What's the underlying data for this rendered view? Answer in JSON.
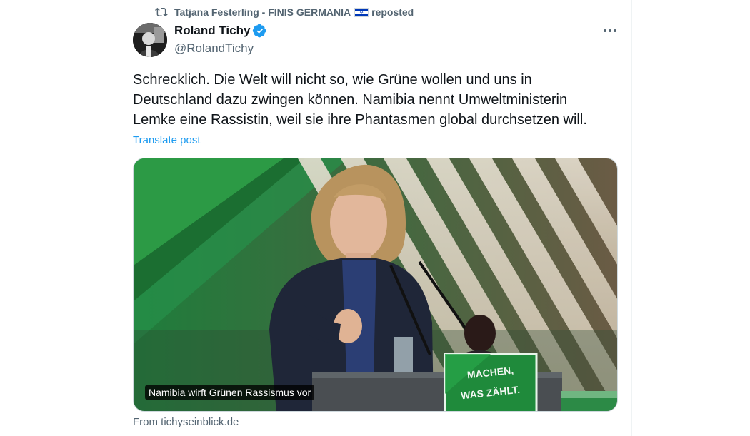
{
  "repost": {
    "reposter": "Tatjana Festerling - FINIS GERMANIA",
    "suffix": "reposted",
    "icon": "repost-icon",
    "flag": "israel-flag-icon"
  },
  "author": {
    "name": "Roland Tichy",
    "handle": "@RolandTichy",
    "verified_icon": "verified-badge-icon",
    "verified_color": "#1d9bf0"
  },
  "post": {
    "lines": [
      "Schrecklich. Die Welt will nicht so, wie Grüne wollen und uns in",
      "Deutschland dazu zwingen können. Namibia nennt Umweltministerin",
      "Lemke eine Rassistin, weil sie ihre Phantasmen global durchsetzen will."
    ],
    "translate_label": "Translate post"
  },
  "card": {
    "caption": "Namibia wirft Grünen Rassismus vor",
    "source": "From tichyseinblick.de",
    "sign_line1": "MACHEN,",
    "sign_line2": "WAS ZÄHLT."
  },
  "colors": {
    "link": "#1d9bf0",
    "secondary_text": "#536471",
    "brand_green": "#1f8a3b"
  }
}
